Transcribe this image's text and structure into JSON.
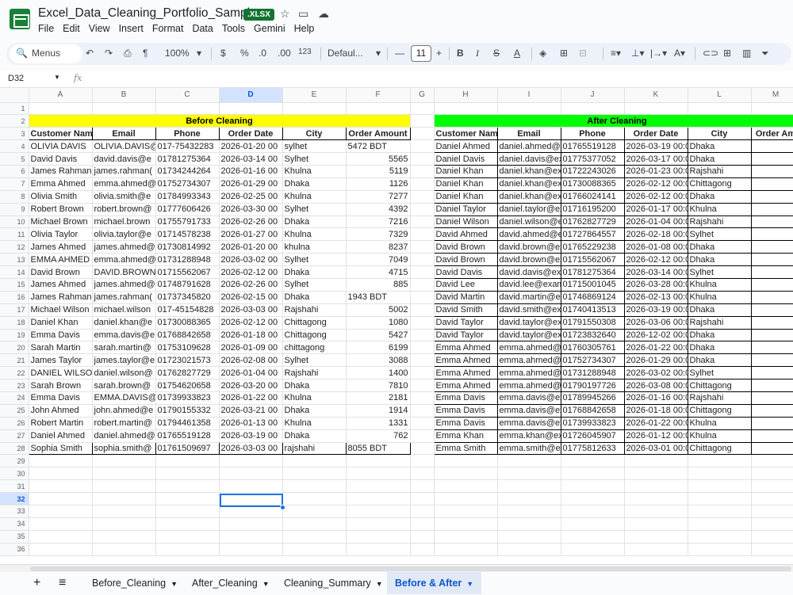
{
  "app": {
    "title": "Excel_Data_Cleaning_Portfolio_Sample",
    "badge": ".XLSX",
    "menus": [
      "File",
      "Edit",
      "View",
      "Insert",
      "Format",
      "Data",
      "Tools",
      "Gemini",
      "Help"
    ]
  },
  "toolbar": {
    "search": "Menus",
    "zoom": "100%",
    "currency": "$",
    "percent": "%",
    "dec_dec": ".0",
    "dec_inc": ".00",
    "num_fmt": "123",
    "font": "Defaul...",
    "font_size": "11"
  },
  "formula": {
    "cell": "D32",
    "fx": "fx"
  },
  "columns": [
    "A",
    "B",
    "C",
    "D",
    "E",
    "F",
    "G",
    "H",
    "I",
    "J",
    "K",
    "L",
    "M"
  ],
  "rows_numbers": [
    "1",
    "2",
    "3",
    "4",
    "5",
    "6",
    "7",
    "8",
    "9",
    "10",
    "11",
    "12",
    "13",
    "14",
    "15",
    "16",
    "17",
    "18",
    "19",
    "20",
    "21",
    "22",
    "23",
    "24",
    "25",
    "26",
    "27",
    "28",
    "29",
    "30",
    "31",
    "32",
    "33",
    "34",
    "35",
    "36"
  ],
  "before": {
    "title": "Before Cleaning",
    "headers": [
      "Customer Name",
      "Email",
      "Phone",
      "Order Date",
      "City",
      "Order Amount"
    ],
    "rows": [
      [
        "OLIVIA DAVIS",
        "OLIVIA.DAVIS@",
        "017-75432283",
        "2026-01-20 00",
        "sylhet",
        "5472 BDT"
      ],
      [
        "David Davis",
        "david.davis@e",
        "01781275364",
        "2026-03-14 00",
        "Sylhet",
        "5565"
      ],
      [
        "James Rahman",
        "james.rahman(",
        "01734244264",
        "2026-01-16 00",
        "Khulna",
        "5119"
      ],
      [
        "Emma Ahmed",
        "emma.ahmed@",
        "01752734307",
        "2026-01-29 00",
        "Dhaka",
        "1126"
      ],
      [
        "Olivia Smith",
        "olivia.smith@e",
        "01784993343",
        "2026-02-25 00",
        "Khulna",
        "7277"
      ],
      [
        "Robert Brown",
        "robert.brown@",
        "01777606426",
        "2026-03-30 00",
        "Sylhet",
        "4392"
      ],
      [
        "Michael Brown",
        "michael.brown",
        "01755791733",
        "2026-02-26 00",
        "Dhaka",
        "7216"
      ],
      [
        "Olivia Taylor",
        "olivia.taylor@e",
        "01714578238",
        "2026-01-27 00",
        "Khulna",
        "7329"
      ],
      [
        "James Ahmed",
        "james.ahmed@",
        "01730814992",
        "2026-01-20 00",
        "khulna",
        "8237"
      ],
      [
        "EMMA AHMED",
        "emma.ahmed@",
        "01731288948",
        "2026-03-02 00",
        "Sylhet",
        "7049"
      ],
      [
        "David Brown",
        "DAVID.BROWN",
        "01715562067",
        "2026-02-12 00",
        "Dhaka",
        "4715"
      ],
      [
        "James Ahmed",
        "james.ahmed@",
        "01748791628",
        "2026-02-26 00",
        "Sylhet",
        "885"
      ],
      [
        "James Rahman",
        "james.rahman(",
        "01737345820",
        "2026-02-15 00",
        "Dhaka",
        "1943 BDT"
      ],
      [
        "Michael Wilson",
        "michael.wilson",
        "017-45154828",
        "2026-03-03 00",
        "Rajshahi",
        "5002"
      ],
      [
        "Daniel Khan",
        "daniel.khan@e",
        "01730088365",
        "2026-02-12 00",
        "Chittagong",
        "1080"
      ],
      [
        "Emma Davis",
        "emma.davis@e",
        "01768842658",
        "2026-01-18 00",
        "Chittagong",
        "5427"
      ],
      [
        "Sarah Martin",
        "sarah.martin@",
        "01753109628",
        "2026-01-09 00",
        "chittagong",
        "6199"
      ],
      [
        "James Taylor",
        "james.taylor@e",
        "01723021573",
        "2026-02-08 00",
        "Sylhet",
        "3088"
      ],
      [
        "DANIEL WILSON",
        "daniel.wilson@",
        "01762827729",
        "2026-01-04 00",
        "Rajshahi",
        "1400"
      ],
      [
        "Sarah Brown",
        "sarah.brown@",
        "01754620658",
        "2026-03-20 00",
        "Dhaka",
        "7810"
      ],
      [
        "Emma Davis",
        "EMMA.DAVIS@",
        "01739933823",
        "2026-01-22 00",
        "Khulna",
        "2181"
      ],
      [
        "John Ahmed",
        "john.ahmed@e",
        "01790155332",
        "2026-03-21 00",
        "Dhaka",
        "1914"
      ],
      [
        "Robert Martin",
        "robert.martin@",
        "01794461358",
        "2026-01-13 00",
        "Khulna",
        "1331"
      ],
      [
        "Daniel Ahmed",
        "daniel.ahmed@",
        "01765519128",
        "2026-03-19 00",
        "Dhaka",
        "762"
      ],
      [
        "Sophia Smith",
        "sophia.smith@",
        "01761509697",
        "2026-03-03 00",
        "rajshahi",
        "8055 BDT"
      ]
    ]
  },
  "after": {
    "title": "After Cleaning",
    "headers": [
      "Customer Name",
      "Email",
      "Phone",
      "Order Date",
      "City",
      "Order Am"
    ],
    "rows": [
      [
        "Daniel Ahmed",
        "daniel.ahmed@e",
        "01765519128",
        "2026-03-19 00:0",
        "Dhaka"
      ],
      [
        "Daniel Davis",
        "daniel.davis@ex",
        "01775377052",
        "2026-03-17 00:0",
        "Dhaka"
      ],
      [
        "Daniel Khan",
        "daniel.khan@ex",
        "01722243026",
        "2026-01-23 00:0",
        "Rajshahi"
      ],
      [
        "Daniel Khan",
        "daniel.khan@ex",
        "01730088365",
        "2026-02-12 00:0",
        "Chittagong"
      ],
      [
        "Daniel Khan",
        "daniel.khan@ex",
        "01766024141",
        "2026-02-12 00:0",
        "Dhaka"
      ],
      [
        "Daniel Taylor",
        "daniel.taylor@ex",
        "01716195200",
        "2026-01-17 00:0",
        "Khulna"
      ],
      [
        "Daniel Wilson",
        "daniel.wilson@e",
        "01762827729",
        "2026-01-04 00:0",
        "Rajshahi"
      ],
      [
        "David Ahmed",
        "david.ahmed@e",
        "01727864557",
        "2026-02-18 00:0",
        "Sylhet"
      ],
      [
        "David Brown",
        "david.brown@ex",
        "01765229238",
        "2026-01-08 00:0",
        "Dhaka"
      ],
      [
        "David Brown",
        "david.brown@ex",
        "01715562067",
        "2026-02-12 00:0",
        "Dhaka"
      ],
      [
        "David Davis",
        "david.davis@exa",
        "01781275364",
        "2026-03-14 00:0",
        "Sylhet"
      ],
      [
        "David Lee",
        "david.lee@exam",
        "01715001045",
        "2026-03-28 00:0",
        "Khulna"
      ],
      [
        "David Martin",
        "david.martin@e",
        "01746869124",
        "2026-02-13 00:0",
        "Khulna"
      ],
      [
        "David Smith",
        "david.smith@ex",
        "01740413513",
        "2026-03-19 00:0",
        "Dhaka"
      ],
      [
        "David Taylor",
        "david.taylor@ex",
        "01791550308",
        "2026-03-06 00:0",
        "Rajshahi"
      ],
      [
        "David Taylor",
        "david.taylor@ex",
        "01723832640",
        "2026-12-02 00:0",
        "Dhaka"
      ],
      [
        "Emma Ahmed",
        "emma.ahmed@e",
        "01760305761",
        "2026-01-22 00:0",
        "Dhaka"
      ],
      [
        "Emma Ahmed",
        "emma.ahmed@e",
        "01752734307",
        "2026-01-29 00:0",
        "Dhaka"
      ],
      [
        "Emma Ahmed",
        "emma.ahmed@e",
        "01731288948",
        "2026-03-02 00:0",
        "Sylhet"
      ],
      [
        "Emma Ahmed",
        "emma.ahmed@e",
        "01790197726",
        "2026-03-08 00:0",
        "Chittagong"
      ],
      [
        "Emma Davis",
        "emma.davis@ex",
        "01789945266",
        "2026-01-16 00:0",
        "Rajshahi"
      ],
      [
        "Emma Davis",
        "emma.davis@ex",
        "01768842658",
        "2026-01-18 00:0",
        "Chittagong"
      ],
      [
        "Emma Davis",
        "emma.davis@ex",
        "01739933823",
        "2026-01-22 00:0",
        "Khulna"
      ],
      [
        "Emma Khan",
        "emma.khan@exa",
        "01726045907",
        "2026-01-12 00:0",
        "Khulna"
      ],
      [
        "Emma Smith",
        "emma.smith@ex",
        "01775812633",
        "2026-03-01 00:0",
        "Chittagong"
      ]
    ]
  },
  "sheets": [
    "Before_Cleaning",
    "After_Cleaning",
    "Cleaning_Summary",
    "Before & After"
  ],
  "colors": {
    "before_fill": "#ffff00",
    "after_fill": "#00ff00",
    "accent": "#0b57d0",
    "brand": "#188038"
  }
}
